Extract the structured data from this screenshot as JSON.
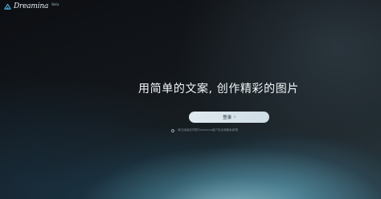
{
  "brand": {
    "name": "Dreamina",
    "badge": "Beta",
    "accent_color": "#4aa8d6"
  },
  "hero": {
    "headline": "用简单的文案, 创作精彩的图片"
  },
  "login": {
    "label": "登录",
    "chevron": "›"
  },
  "agreement": {
    "text": "我已阅读并同意Dreamina用户协议和隐私政策"
  },
  "colors": {
    "glow": "#8fcad9",
    "button_bg": "#dfe9ef"
  }
}
